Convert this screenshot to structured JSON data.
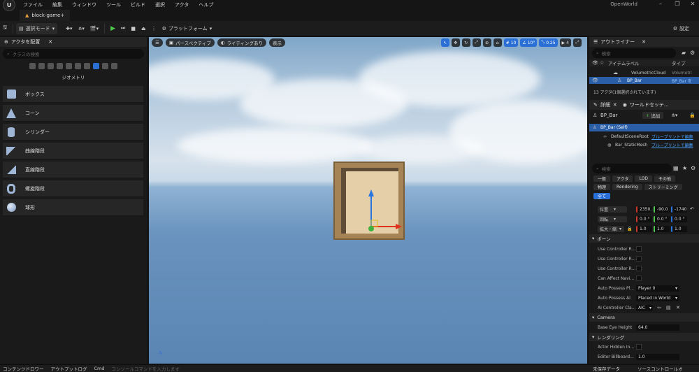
{
  "menubar": {
    "items": [
      "ファイル",
      "編集",
      "ウィンドウ",
      "ツール",
      "ビルド",
      "選択",
      "アクタ",
      "ヘルプ"
    ],
    "window_title": "OpenWorld"
  },
  "project_tab": "block-game+",
  "toolbar": {
    "select_mode": "選択モード",
    "platform": "プラットフォーム",
    "settings": "設定"
  },
  "left_panel": {
    "tab_title": "アクタを配置",
    "search_placeholder": "クラスの検索",
    "category_label": "ジオメトリ",
    "items": [
      "ボックス",
      "コーン",
      "シリンダー",
      "曲線階段",
      "直線階段",
      "螺旋階段",
      "球形"
    ]
  },
  "viewport": {
    "perspective": "パースペクティブ",
    "lighting": "ライティングあり",
    "show": "表示",
    "grid_snap": "10",
    "rotation_snap": "10°",
    "scale_snap": "0.25",
    "camera_speed": "4"
  },
  "outliner": {
    "tab_title": "アウトライナー",
    "search_placeholder": "検索",
    "col_label": "アイテムラベル",
    "col_type": "タイプ",
    "rows": [
      {
        "label": "VolumetricCloud",
        "type": "Volumetri"
      },
      {
        "label": "BP_Bar",
        "type": "BP_Bar を"
      }
    ],
    "status": "13 アクタ(1個選択されています)"
  },
  "details": {
    "tab_details": "詳細",
    "tab_world": "ワールドセッテ...",
    "actor_name": "BP_Bar",
    "add_button": "追加",
    "components": [
      {
        "name": "BP_Bar (Self)",
        "link": ""
      },
      {
        "name": "DefaultSceneRoot",
        "link": "ブループリントで編集"
      },
      {
        "name": "Bar_StaticMesh",
        "link": "ブループリントで編集"
      }
    ],
    "search_placeholder": "検索",
    "filters_row1": [
      "一般",
      "アクタ",
      "LOD",
      "その他"
    ],
    "filters_row2": [
      "物理",
      "Rendering",
      "ストリーミング"
    ],
    "filter_all": "全て",
    "transform": {
      "location_label": "位置",
      "location": [
        "2350.",
        "-90.0",
        "-1740"
      ],
      "rotation_label": "回転",
      "rotation": [
        "0.0 °",
        "0.0 °",
        "0.0 °"
      ],
      "scale_label": "拡大・縮",
      "scale": [
        "1.0",
        "1.0",
        "1.0"
      ]
    },
    "pawn_section": "ポーン",
    "pawn_props": [
      {
        "label": "Use Controller R...",
        "value": ""
      },
      {
        "label": "Use Controller R...",
        "value": ""
      },
      {
        "label": "Use Controller R...",
        "value": ""
      },
      {
        "label": "Can Affect Navi...",
        "value": ""
      },
      {
        "label": "Auto Possess Pl...",
        "value": "Player 0"
      },
      {
        "label": "Auto Possess AI",
        "value": "Placed in World"
      },
      {
        "label": "AI Controller Cla...",
        "value": "AIC"
      }
    ],
    "camera_section": "Camera",
    "base_eye_label": "Base Eye Height",
    "base_eye_value": "64.0",
    "render_section": "レンダリング",
    "actor_hidden_label": "Actor Hidden In...",
    "editor_billboard_label": "Editor Billboard...",
    "editor_billboard_value": "1.0"
  },
  "bottom_bar": {
    "items": [
      "コンテンツドロワー",
      "アウトプットログ",
      "Cmd"
    ],
    "console_placeholder": "コンソールコマンドを入力します",
    "right_items": [
      "未保存データ",
      "ソースコントロールオ"
    ]
  }
}
